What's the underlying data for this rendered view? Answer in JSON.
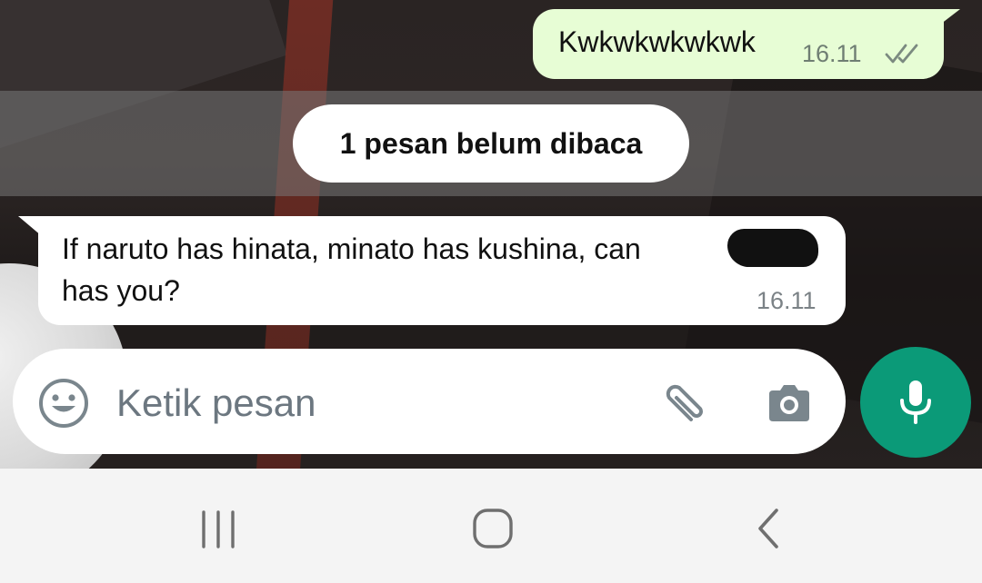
{
  "chat": {
    "outgoing_message": {
      "text": "Kwkwkwkwkwk",
      "time": "16.11",
      "status_icon": "double-check-icon"
    },
    "unread_banner": "1 pesan belum dibaca",
    "incoming_message": {
      "line1": "If naruto has hinata, minato has kushina, can",
      "line2": "has you?",
      "time": "16.11"
    }
  },
  "composer": {
    "placeholder": "Ketik pesan",
    "emoji_icon": "emoji-icon",
    "attach_icon": "paperclip-icon",
    "camera_icon": "camera-icon",
    "mic_icon": "microphone-icon"
  },
  "navigation": {
    "recents_icon": "recents-icon",
    "home_icon": "home-icon",
    "back_icon": "back-icon"
  },
  "colors": {
    "outgoing_bubble": "#e7fdd5",
    "incoming_bubble": "#ffffff",
    "accent": "#0b9a78",
    "nav_background": "#f4f4f4"
  }
}
